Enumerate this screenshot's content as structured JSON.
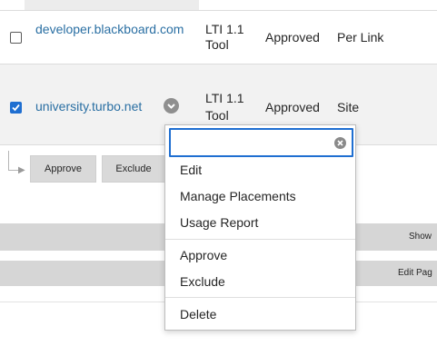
{
  "rows": [
    {
      "name": "developer.blackboard.com",
      "type_line1": "LTI 1.1",
      "type_line2": "Tool",
      "status": "Approved",
      "placement": "Per Link",
      "checked": false
    },
    {
      "name": "university.turbo.net",
      "type_line1": "LTI 1.1",
      "type_line2": "Tool",
      "status": "Approved",
      "placement": "Site",
      "checked": true
    }
  ],
  "actions": {
    "approve": "Approve",
    "exclude": "Exclude"
  },
  "bars": {
    "show_label": "Show",
    "edit_label": "Edit Pag"
  },
  "menu": {
    "search_value": "",
    "items_group1": [
      "Edit",
      "Manage Placements",
      "Usage Report"
    ],
    "items_group2": [
      "Approve",
      "Exclude"
    ],
    "items_group3": [
      "Delete"
    ]
  },
  "colors": {
    "link": "#2a6fa3",
    "accent": "#1f6fd1",
    "row_selected_bg": "#f2f2f2",
    "bar_bg": "#d6d6d6"
  },
  "icons": {
    "row_menu": "chevron-down-icon",
    "clear": "clear-icon",
    "checkmark": "checkmark-icon",
    "elbow": "elbow-arrow-icon"
  }
}
